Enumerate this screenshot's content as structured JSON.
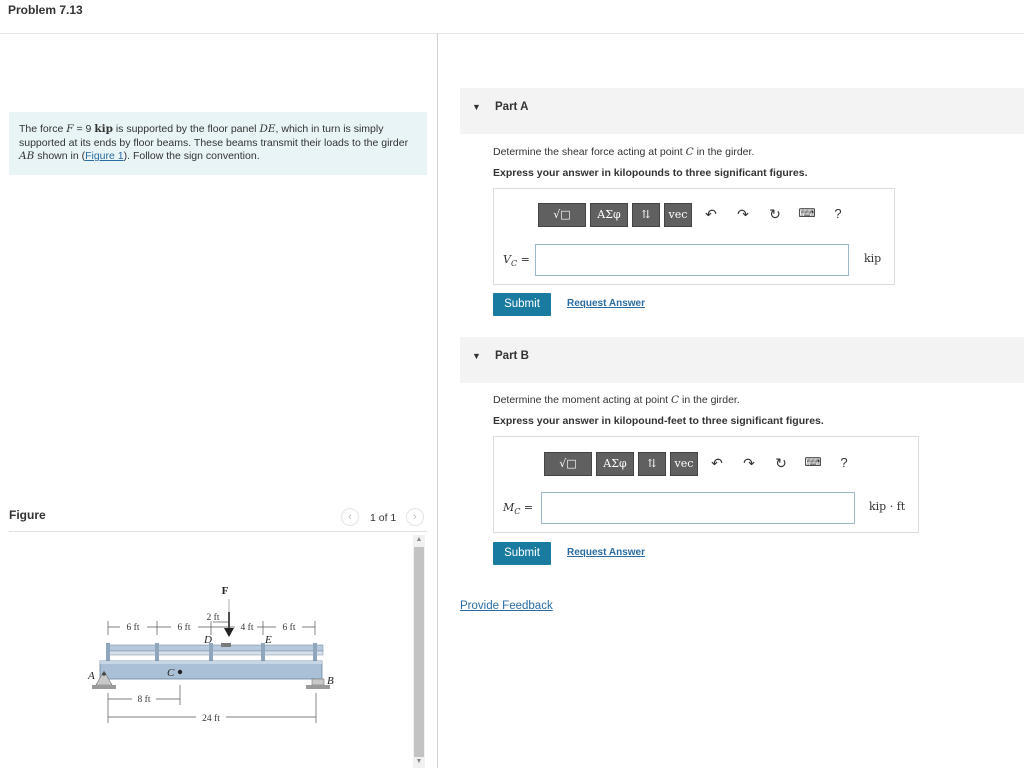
{
  "problem": {
    "title": "Problem 7.13",
    "statement": {
      "p1": "The force ",
      "F": "F",
      "p2": " = 9 ",
      "unit": "kip",
      "p3": " is supported by the floor panel ",
      "DE": "DE",
      "p4": ", which in turn is simply supported at its ends by floor beams. These beams transmit their loads to the girder ",
      "AB": "AB",
      "p5": " shown in (",
      "figure_link": "Figure 1",
      "p6": "). Follow the sign convention."
    }
  },
  "figure": {
    "label": "Figure",
    "pager_text": "1 of 1",
    "prev_icon": "chevron-left-icon",
    "next_icon": "chevron-right-icon",
    "labels": {
      "F": "F",
      "dim_2ft": "2 ft",
      "dim_6ft_a": "6 ft",
      "dim_6ft_b": "6 ft",
      "dim_4ft": "4 ft",
      "dim_6ft_c": "6 ft",
      "D": "D",
      "E": "E",
      "A": "A",
      "B": "B",
      "C": "C",
      "dim_8ft": "8 ft",
      "dim_24ft": "24 ft"
    }
  },
  "toolbar": {
    "templates": "√□",
    "greek": "ΑΣφ",
    "vec": "vec",
    "arrows": "⇅",
    "undo_icon": "undo-icon",
    "redo_icon": "redo-icon",
    "reset_icon": "reset-icon",
    "keyboard_icon": "keyboard-icon",
    "help": "?"
  },
  "parts": [
    {
      "label": "Part A",
      "q1": "Determine the shear force acting at point ",
      "point": "C",
      "q2": " in the girder.",
      "instruction": "Express your answer in kilopounds to three significant figures.",
      "var": "V",
      "var_sub": "C",
      "equals": " =",
      "input_value": "",
      "unit": "kip",
      "submit": "Submit",
      "request": "Request Answer"
    },
    {
      "label": "Part B",
      "q1": "Determine the moment acting at point ",
      "point": "C",
      "q2": " in the girder.",
      "instruction": "Express your answer in kilopound-feet to three significant figures.",
      "var": "M",
      "var_sub": "C",
      "equals": " =",
      "input_value": "",
      "unit": "kip · ft",
      "submit": "Submit",
      "request": "Request Answer"
    }
  ],
  "feedback": "Provide Feedback"
}
